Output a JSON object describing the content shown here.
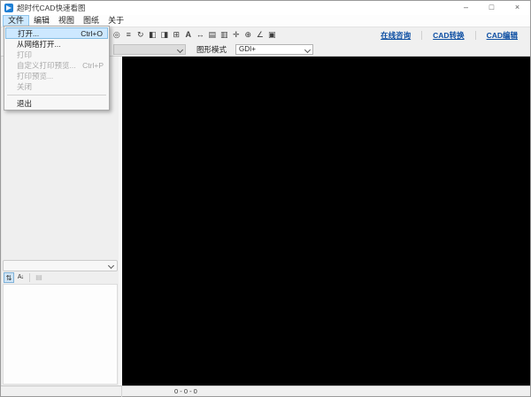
{
  "window": {
    "title": "超时代CAD快速看图",
    "controls": {
      "minimize": "–",
      "maximize": "□",
      "close": "×"
    }
  },
  "menubar": {
    "items": [
      {
        "label": "文件"
      },
      {
        "label": "编辑"
      },
      {
        "label": "视图"
      },
      {
        "label": "图纸"
      },
      {
        "label": "关于"
      }
    ]
  },
  "file_menu": {
    "items": [
      {
        "label": "打开...",
        "shortcut": "Ctrl+O"
      },
      {
        "label": "从网络打开...",
        "shortcut": ""
      },
      {
        "label": "打印",
        "shortcut": ""
      },
      {
        "label": "自定义打印预览...",
        "shortcut": "Ctrl+P"
      },
      {
        "label": "打印预览...",
        "shortcut": ""
      },
      {
        "label": "关闭",
        "shortcut": ""
      },
      {
        "label": "退出",
        "shortcut": ""
      }
    ]
  },
  "toolbar": {
    "icons": [
      {
        "name": "eye-icon",
        "glyph": "◎"
      },
      {
        "name": "layers-icon",
        "glyph": "≡"
      },
      {
        "name": "rotate-icon",
        "glyph": "↻"
      },
      {
        "name": "invert-colors-icon",
        "glyph": "◧"
      },
      {
        "name": "background-toggle-icon",
        "glyph": "◨"
      },
      {
        "name": "fit-view-icon",
        "glyph": "⊞"
      },
      {
        "name": "text-annotation-icon",
        "glyph": "A"
      },
      {
        "name": "measure-length-icon",
        "glyph": "↔"
      },
      {
        "name": "sheet-layout-icon",
        "glyph": "▤"
      },
      {
        "name": "print-icon",
        "glyph": "▥"
      },
      {
        "name": "pan-icon",
        "glyph": "✛"
      },
      {
        "name": "zoom-in-icon",
        "glyph": "⊕"
      },
      {
        "name": "measure-angle-icon",
        "glyph": "∠"
      },
      {
        "name": "copy-icon",
        "glyph": "▣"
      }
    ],
    "links": [
      {
        "label": "在线咨询"
      },
      {
        "label": "CAD转换"
      },
      {
        "label": "CAD编辑"
      }
    ]
  },
  "options_row": {
    "layer_combo_value": "",
    "render_mode_label": "图形模式",
    "render_mode_value": "GDI+"
  },
  "sidebar": {
    "combo_value": "",
    "sort_buttons": {
      "categorized_glyph": "⇅",
      "alphabetical_glyph": "A↓",
      "pages_glyph": "▤"
    }
  },
  "statusbar": {
    "coordinates": "0 - 0 - 0"
  },
  "colors": {
    "accent_blue": "#1f7fd4",
    "link_blue": "#0b4da2",
    "highlight_bg": "#cde8ff",
    "canvas": "#000000"
  }
}
